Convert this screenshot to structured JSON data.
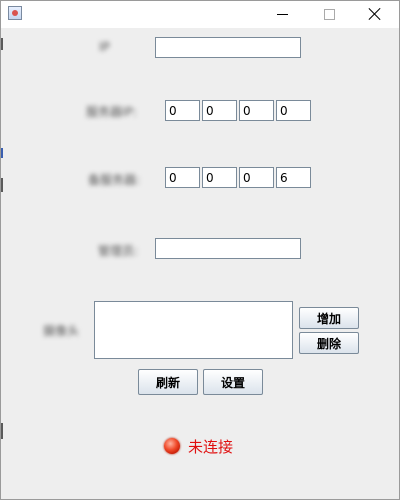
{
  "window": {
    "title": ""
  },
  "form": {
    "ip_label": "IP",
    "server_ip_label": "服务器IP:",
    "server_ip_octets": [
      "0",
      "0",
      "0",
      "0"
    ],
    "second_ip_label": "备服务器:",
    "second_ip_octets": [
      "0",
      "0",
      "0",
      "6"
    ],
    "third_label": "管理员:",
    "third_value": "",
    "list_label": "摄像头",
    "list_value": ""
  },
  "buttons": {
    "add": "增加",
    "delete": "删除",
    "refresh": "刷新",
    "settings": "设置"
  },
  "status": {
    "text": "未连接",
    "color": "#e01010"
  }
}
